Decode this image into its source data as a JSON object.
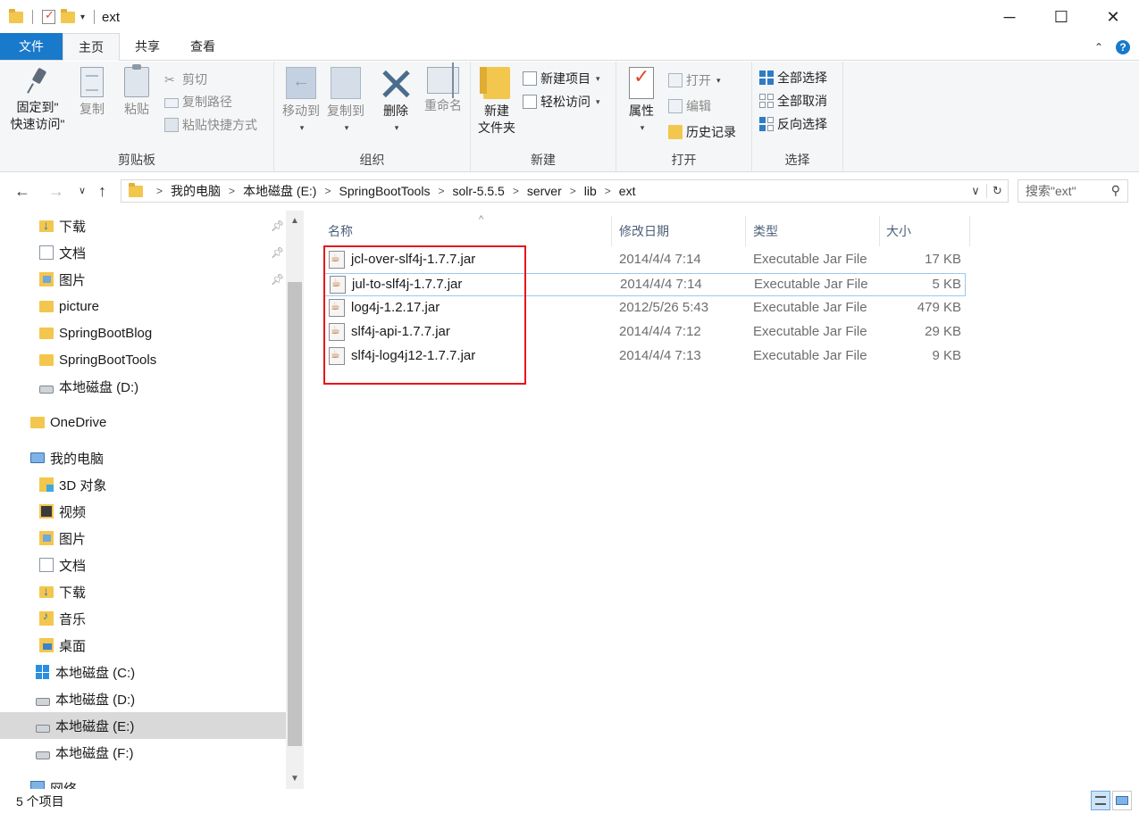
{
  "window": {
    "title": "ext",
    "controls": {
      "minimize": "─",
      "maximize": "☐",
      "close": "✕"
    }
  },
  "ribbon": {
    "tabs": [
      "文件",
      "主页",
      "共享",
      "查看"
    ],
    "active_tab": "主页",
    "clipboard": {
      "pin_label_line1": "固定到\"",
      "pin_label_line2": "快速访问\"",
      "copy": "复制",
      "paste": "粘贴",
      "cut": "剪切",
      "copy_path": "复制路径",
      "paste_shortcut": "粘贴快捷方式",
      "group": "剪贴板"
    },
    "organize": {
      "move_to": "移动到",
      "copy_to": "复制到",
      "delete": "删除",
      "rename": "重命名",
      "group": "组织"
    },
    "new": {
      "new_item": "新建项目",
      "easy_access": "轻松访问",
      "new_folder_line1": "新建",
      "new_folder_line2": "文件夹",
      "group": "新建"
    },
    "open": {
      "properties": "属性",
      "open": "打开",
      "edit": "编辑",
      "history": "历史记录",
      "group": "打开"
    },
    "select": {
      "select_all": "全部选择",
      "select_none": "全部取消",
      "invert": "反向选择",
      "group": "选择"
    }
  },
  "address": {
    "crumbs": [
      "我的电脑",
      "本地磁盘 (E:)",
      "SpringBootTools",
      "solr-5.5.5",
      "server",
      "lib",
      "ext"
    ],
    "search_placeholder": "搜索\"ext\""
  },
  "sidebar": {
    "quick_access": [
      {
        "label": "下载",
        "icon": "download-folder-icon",
        "pinned": true
      },
      {
        "label": "文档",
        "icon": "documents-icon",
        "pinned": true
      },
      {
        "label": "图片",
        "icon": "pictures-icon",
        "pinned": true
      },
      {
        "label": "picture",
        "icon": "folder-icon",
        "pinned": false
      },
      {
        "label": "SpringBootBlog",
        "icon": "folder-icon",
        "pinned": false
      },
      {
        "label": "SpringBootTools",
        "icon": "folder-icon",
        "pinned": false
      },
      {
        "label": "本地磁盘 (D:)",
        "icon": "drive-icon",
        "pinned": false
      }
    ],
    "onedrive": "OneDrive",
    "this_pc": "我的电脑",
    "pc_items": [
      {
        "label": "3D 对象",
        "icon": "3d-objects-icon"
      },
      {
        "label": "视频",
        "icon": "videos-icon"
      },
      {
        "label": "图片",
        "icon": "pictures-icon"
      },
      {
        "label": "文档",
        "icon": "documents-icon"
      },
      {
        "label": "下载",
        "icon": "download-folder-icon"
      },
      {
        "label": "音乐",
        "icon": "music-icon"
      },
      {
        "label": "桌面",
        "icon": "desktop-icon"
      },
      {
        "label": "本地磁盘 (C:)",
        "icon": "windows-drive-icon"
      },
      {
        "label": "本地磁盘 (D:)",
        "icon": "drive-icon"
      },
      {
        "label": "本地磁盘 (E:)",
        "icon": "drive-icon",
        "selected": true
      },
      {
        "label": "本地磁盘 (F:)",
        "icon": "drive-icon"
      }
    ],
    "network": "网络"
  },
  "columns": [
    "名称",
    "修改日期",
    "类型",
    "大小"
  ],
  "files": [
    {
      "name": "jcl-over-slf4j-1.7.7.jar",
      "date": "2014/4/4 7:14",
      "type": "Executable Jar File",
      "size": "17 KB"
    },
    {
      "name": "jul-to-slf4j-1.7.7.jar",
      "date": "2014/4/4 7:14",
      "type": "Executable Jar File",
      "size": "5 KB"
    },
    {
      "name": "log4j-1.2.17.jar",
      "date": "2012/5/26 5:43",
      "type": "Executable Jar File",
      "size": "479 KB"
    },
    {
      "name": "slf4j-api-1.7.7.jar",
      "date": "2014/4/4 7:12",
      "type": "Executable Jar File",
      "size": "29 KB"
    },
    {
      "name": "slf4j-log4j12-1.7.7.jar",
      "date": "2014/4/4 7:13",
      "type": "Executable Jar File",
      "size": "9 KB"
    }
  ],
  "status": {
    "count": "5 个项目"
  },
  "colors": {
    "accent": "#1979ca",
    "highlight_box": "#e8141b",
    "selected_nav": "#d9d9d9"
  }
}
